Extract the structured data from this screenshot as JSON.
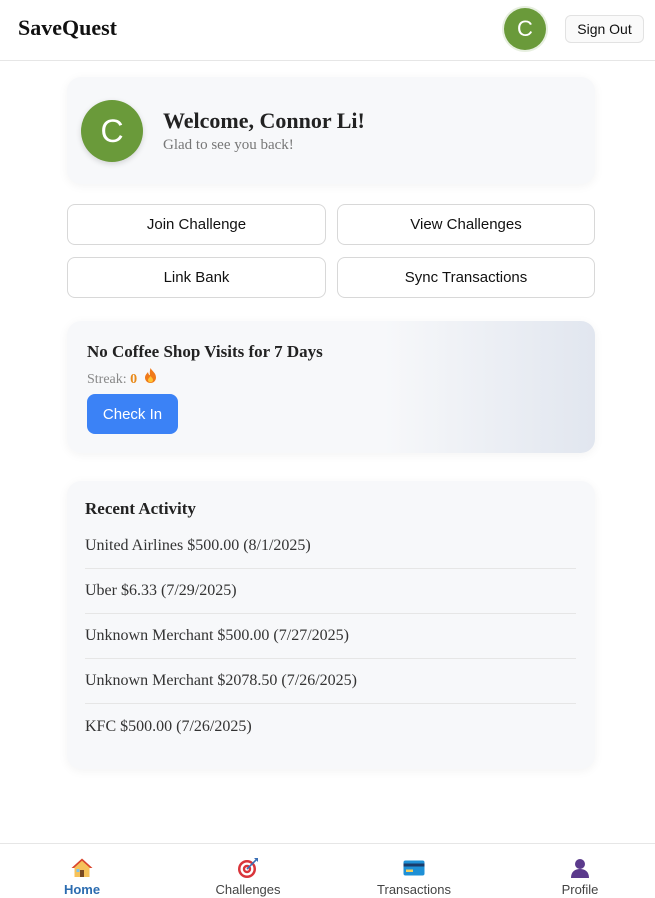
{
  "header": {
    "brand": "SaveQuest",
    "avatar_initial": "C",
    "sign_out_label": "Sign Out"
  },
  "welcome": {
    "avatar_initial": "C",
    "title": "Welcome, Connor Li!",
    "subtitle": "Glad to see you back!"
  },
  "actions": {
    "join_challenge": "Join Challenge",
    "view_challenges": "View Challenges",
    "link_bank": "Link Bank",
    "sync_transactions": "Sync Transactions"
  },
  "challenge": {
    "title": "No Coffee Shop Visits for 7 Days",
    "streak_label": "Streak:",
    "streak_value": "0",
    "streak_icon": "flame-icon",
    "check_in_label": "Check In"
  },
  "activity": {
    "title": "Recent Activity",
    "items": [
      "United Airlines $500.00 (8/1/2025)",
      "Uber $6.33 (7/29/2025)",
      "Unknown Merchant $500.00 (7/27/2025)",
      "Unknown Merchant $2078.50 (7/26/2025)",
      "KFC $500.00 (7/26/2025)"
    ]
  },
  "nav": {
    "items": [
      {
        "label": "Home",
        "icon": "house-icon",
        "active": true
      },
      {
        "label": "Challenges",
        "icon": "target-icon",
        "active": false
      },
      {
        "label": "Transactions",
        "icon": "credit-card-icon",
        "active": false
      },
      {
        "label": "Profile",
        "icon": "person-icon",
        "active": false
      }
    ]
  },
  "colors": {
    "accent_blue": "#3b82f6",
    "avatar_green": "#6a9a3a",
    "active_nav": "#2b6cb0",
    "streak_orange": "#e88a1a"
  }
}
